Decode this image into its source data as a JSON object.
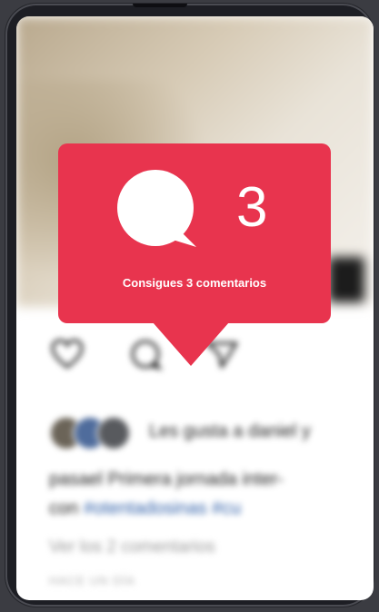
{
  "notification": {
    "count": "3",
    "message": "Consigues 3 comentarios",
    "icon": "comment-bubble-icon",
    "color": "#e8344e"
  },
  "post": {
    "likes_text": "Les gusta a daniel y",
    "caption_line1": "pasael Primera jornada inter-",
    "caption_line2_prefix": "con ",
    "caption_line2_tag": "#otentadosinas #cu",
    "view_comments": "Ver los 2 comentarios",
    "time_ago": "HACE UN DÍA"
  }
}
